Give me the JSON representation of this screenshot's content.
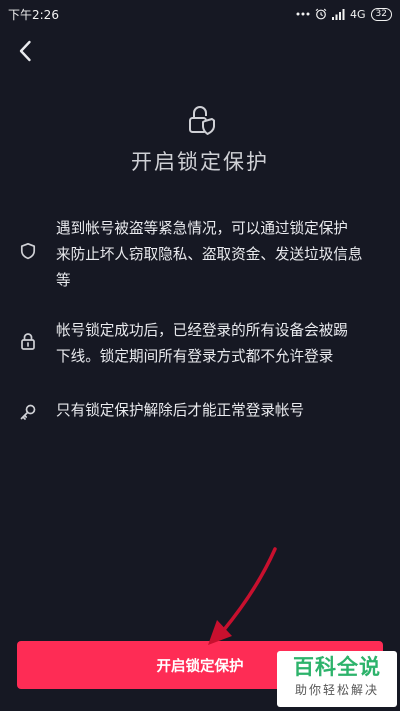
{
  "status_bar": {
    "time": "下午2:26",
    "network": "4G",
    "battery": "32"
  },
  "page": {
    "title": "开启锁定保护"
  },
  "features": [
    {
      "icon": "shield-icon",
      "text": "遇到帐号被盗等紧急情况，可以通过锁定保护\n来防止坏人窃取隐私、盗取资金、发送垃圾信息\n等"
    },
    {
      "icon": "lock-icon",
      "text": "帐号锁定成功后，已经登录的所有设备会被踢\n下线。锁定期间所有登录方式都不允许登录"
    },
    {
      "icon": "key-icon",
      "text": "只有锁定保护解除后才能正常登录帐号"
    }
  ],
  "action": {
    "button_label": "开启锁定保护"
  },
  "watermark": {
    "main": "百科全说",
    "sub": "助你轻松解决"
  },
  "colors": {
    "background": "#161823",
    "accent": "#fe2c55",
    "arrow": "#c8102e",
    "watermark_green": "#2db36b"
  }
}
